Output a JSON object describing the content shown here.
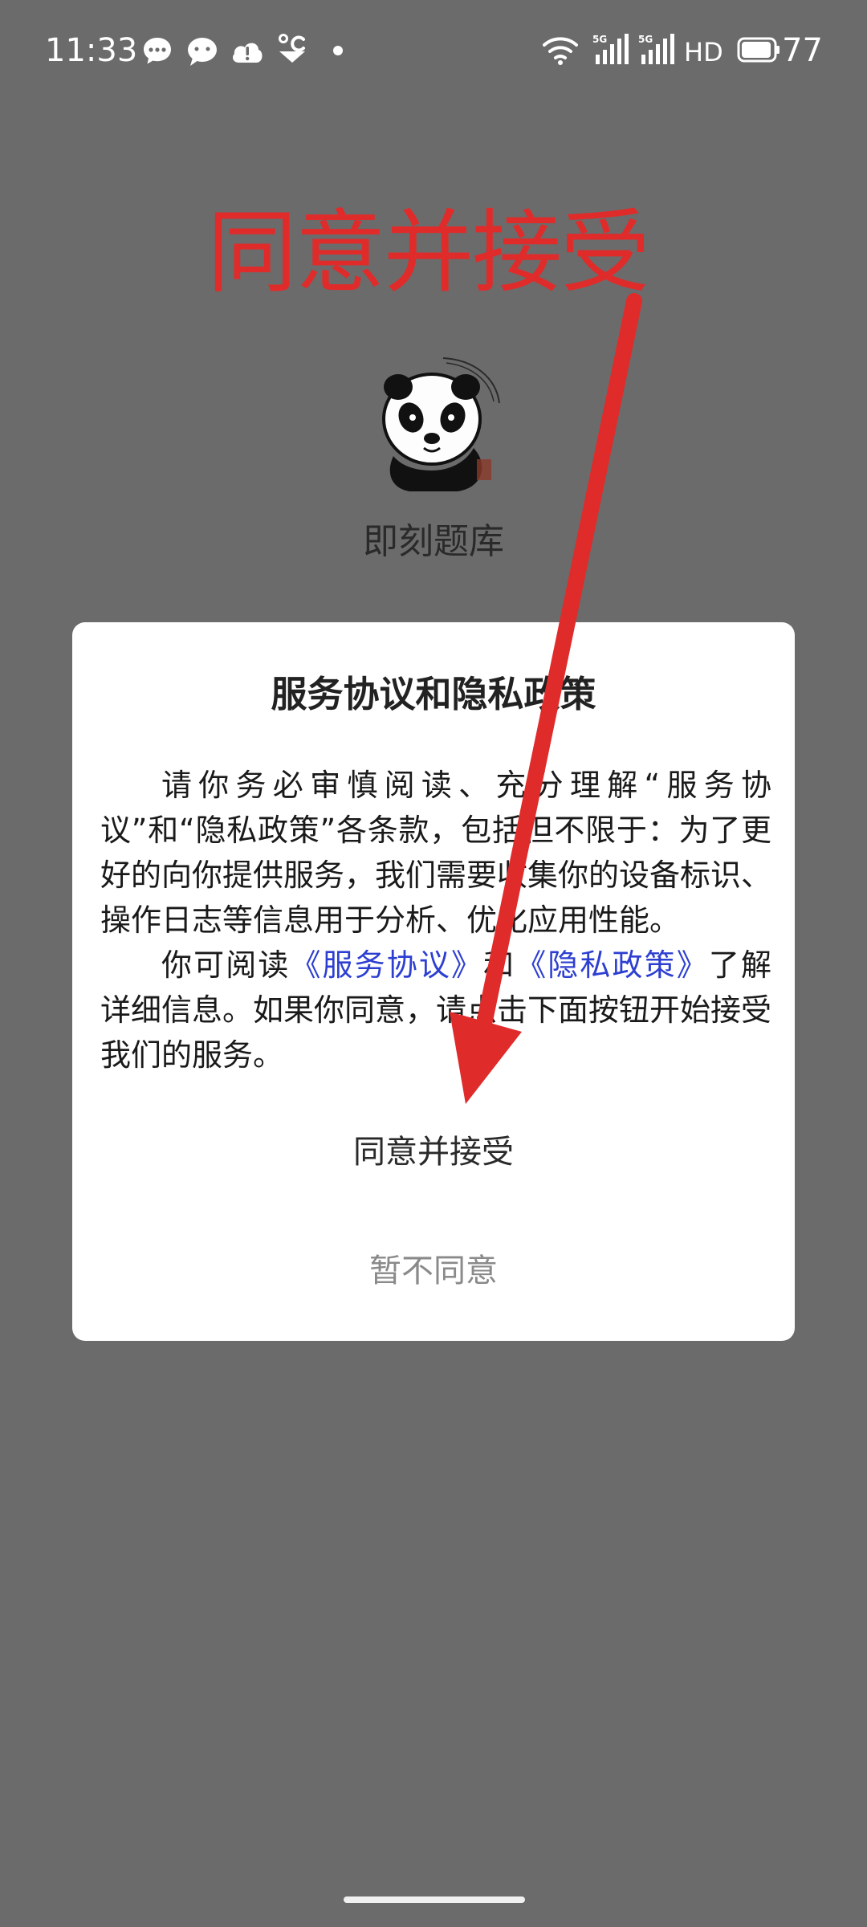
{
  "status_bar": {
    "time": "11:33",
    "battery": "77",
    "notification_icons": [
      "message-bubble-icon",
      "chat-bubble-icon",
      "alert-cloud-icon",
      "weather-icon",
      "dot-icon"
    ],
    "system_icons": [
      "wifi-icon",
      "signal-5g-icon",
      "signal-5g-icon",
      "hd-icon",
      "battery-icon"
    ],
    "network_label": "5G",
    "hd_label": "HD"
  },
  "annotation": {
    "text": "同意并接受",
    "color": "#e02b2b"
  },
  "app": {
    "name": "即刻题库"
  },
  "dialog": {
    "title": "服务协议和隐私政策",
    "paragraph1": "请你务必审慎阅读、充分理解“服务协议”和“隐私政策”各条款，包括但不限于：为了更好的向你提供服务，我们需要收集你的设备标识、操作日志等信息用于分析、优化应用性能。",
    "paragraph2_prefix": "你可阅读",
    "service_link": "《服务协议》",
    "paragraph2_and": "和",
    "privacy_link": "《隐私政策》",
    "paragraph2_suffix": "了解详细信息。如果你同意，请点击下面按钮开始接受我们的服务。",
    "accept_label": "同意并接受",
    "decline_label": "暂不同意",
    "link_color": "#2d3fd1"
  },
  "colors": {
    "background": "#6b6b6b",
    "dialog_bg": "#ffffff"
  }
}
